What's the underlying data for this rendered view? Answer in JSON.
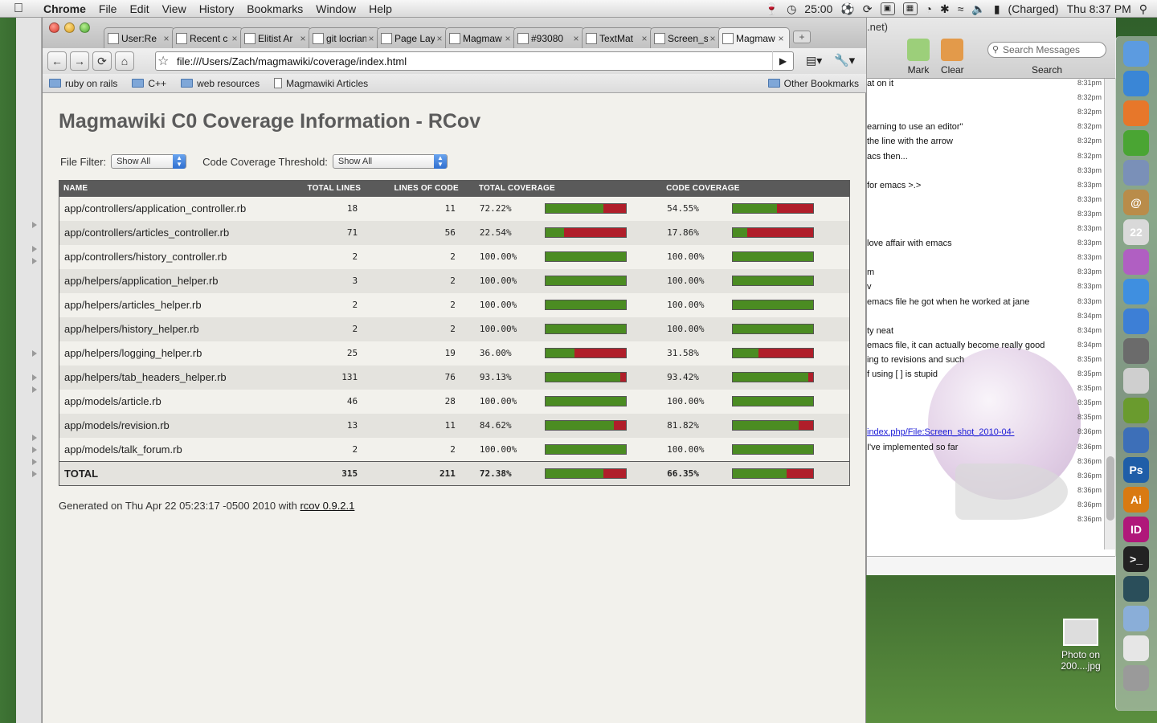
{
  "menubar": {
    "app": "Chrome",
    "items": [
      "File",
      "Edit",
      "View",
      "History",
      "Bookmarks",
      "Window",
      "Help"
    ],
    "timer": "25:00",
    "battery": "(Charged)",
    "clock": "Thu 8:37 PM"
  },
  "tabs": [
    {
      "label": "User:Re",
      "active": false
    },
    {
      "label": "Recent c",
      "active": false
    },
    {
      "label": "Elitist Ar",
      "active": false
    },
    {
      "label": "git locriani",
      "active": false
    },
    {
      "label": "Page Lay",
      "active": false
    },
    {
      "label": "Magmaw",
      "active": false
    },
    {
      "label": "#93080",
      "active": false
    },
    {
      "label": "TextMat",
      "active": false
    },
    {
      "label": "Screen_s",
      "active": false
    },
    {
      "label": "Magmaw",
      "active": true
    }
  ],
  "toolbar": {
    "url": "file:///Users/Zach/magmawiki/coverage/index.html"
  },
  "bookmarks": {
    "items": [
      {
        "label": "ruby on rails",
        "type": "folder"
      },
      {
        "label": "C++",
        "type": "folder"
      },
      {
        "label": "web resources",
        "type": "folder"
      },
      {
        "label": "Magmawiki Articles",
        "type": "page"
      }
    ],
    "other": "Other Bookmarks"
  },
  "page": {
    "title": "Magmawiki C0 Coverage Information - RCov",
    "file_filter_label": "File Filter:",
    "file_filter_value": "Show All",
    "threshold_label": "Code Coverage Threshold:",
    "threshold_value": "Show All",
    "headers": {
      "name": "NAME",
      "total_lines": "TOTAL LINES",
      "lines_of_code": "LINES OF CODE",
      "total_coverage": "TOTAL COVERAGE",
      "code_coverage": "CODE COVERAGE"
    },
    "rows": [
      {
        "name": "app/controllers/application_controller.rb",
        "total_lines": "18",
        "loc": "11",
        "total_cov": "72.22%",
        "total_frac": 0.7222,
        "code_cov": "54.55%",
        "code_frac": 0.5455
      },
      {
        "name": "app/controllers/articles_controller.rb",
        "total_lines": "71",
        "loc": "56",
        "total_cov": "22.54%",
        "total_frac": 0.2254,
        "code_cov": "17.86%",
        "code_frac": 0.1786
      },
      {
        "name": "app/controllers/history_controller.rb",
        "total_lines": "2",
        "loc": "2",
        "total_cov": "100.00%",
        "total_frac": 1.0,
        "code_cov": "100.00%",
        "code_frac": 1.0
      },
      {
        "name": "app/helpers/application_helper.rb",
        "total_lines": "3",
        "loc": "2",
        "total_cov": "100.00%",
        "total_frac": 1.0,
        "code_cov": "100.00%",
        "code_frac": 1.0
      },
      {
        "name": "app/helpers/articles_helper.rb",
        "total_lines": "2",
        "loc": "2",
        "total_cov": "100.00%",
        "total_frac": 1.0,
        "code_cov": "100.00%",
        "code_frac": 1.0
      },
      {
        "name": "app/helpers/history_helper.rb",
        "total_lines": "2",
        "loc": "2",
        "total_cov": "100.00%",
        "total_frac": 1.0,
        "code_cov": "100.00%",
        "code_frac": 1.0
      },
      {
        "name": "app/helpers/logging_helper.rb",
        "total_lines": "25",
        "loc": "19",
        "total_cov": "36.00%",
        "total_frac": 0.36,
        "code_cov": "31.58%",
        "code_frac": 0.3158
      },
      {
        "name": "app/helpers/tab_headers_helper.rb",
        "total_lines": "131",
        "loc": "76",
        "total_cov": "93.13%",
        "total_frac": 0.9313,
        "code_cov": "93.42%",
        "code_frac": 0.9342
      },
      {
        "name": "app/models/article.rb",
        "total_lines": "46",
        "loc": "28",
        "total_cov": "100.00%",
        "total_frac": 1.0,
        "code_cov": "100.00%",
        "code_frac": 1.0
      },
      {
        "name": "app/models/revision.rb",
        "total_lines": "13",
        "loc": "11",
        "total_cov": "84.62%",
        "total_frac": 0.8462,
        "code_cov": "81.82%",
        "code_frac": 0.8182
      },
      {
        "name": "app/models/talk_forum.rb",
        "total_lines": "2",
        "loc": "2",
        "total_cov": "100.00%",
        "total_frac": 1.0,
        "code_cov": "100.00%",
        "code_frac": 1.0
      }
    ],
    "total": {
      "name": "TOTAL",
      "total_lines": "315",
      "loc": "211",
      "total_cov": "72.38%",
      "total_frac": 0.7238,
      "code_cov": "66.35%",
      "code_frac": 0.6635
    },
    "footer_text": "Generated on Thu Apr 22 05:23:17 -0500 2010 with",
    "footer_link": "rcov 0.9.2.1"
  },
  "colors": {
    "covered": "#4b8c22",
    "uncovered": "#b01e2a",
    "header": "#5a5a5a"
  },
  "chat": {
    "title_fragment": ".net)",
    "mark_label": "Mark",
    "clear_label": "Clear",
    "search_placeholder": "Search Messages",
    "search_label": "Search",
    "messages": [
      {
        "text": "at on it",
        "time": "8:31pm"
      },
      {
        "text": "",
        "time": "8:32pm"
      },
      {
        "text": "",
        "time": "8:32pm"
      },
      {
        "text": "earning to use an editor\"",
        "time": "8:32pm"
      },
      {
        "text": "the line with the arrow",
        "time": "8:32pm"
      },
      {
        "text": "acs then...",
        "time": "8:32pm"
      },
      {
        "text": "",
        "time": "8:33pm"
      },
      {
        "text": "for emacs >.>",
        "time": "8:33pm"
      },
      {
        "text": "",
        "time": "8:33pm"
      },
      {
        "text": "",
        "time": "8:33pm"
      },
      {
        "text": "",
        "time": "8:33pm"
      },
      {
        "text": "love affair with emacs",
        "time": "8:33pm"
      },
      {
        "text": "",
        "time": "8:33pm"
      },
      {
        "text": "m",
        "time": "8:33pm"
      },
      {
        "text": "v",
        "time": "8:33pm"
      },
      {
        "text": "emacs file he got when he worked at jane",
        "time": "8:33pm"
      },
      {
        "text": "",
        "time": "8:34pm"
      },
      {
        "text": "ty neat",
        "time": "8:34pm"
      },
      {
        "text": "emacs file, it can actually become really good",
        "time": "8:34pm"
      },
      {
        "text": "ing to revisions and such",
        "time": "8:35pm"
      },
      {
        "text": "f using [ ] is stupid",
        "time": "8:35pm"
      },
      {
        "text": "",
        "time": "8:35pm"
      },
      {
        "text": "",
        "time": "8:35pm"
      },
      {
        "text": "",
        "time": "8:35pm"
      },
      {
        "text": "index.php/File:Screen_shot_2010-04-",
        "time": "8:36pm",
        "link": true
      },
      {
        "text": "I've implemented so far",
        "time": "8:36pm"
      },
      {
        "text": "",
        "time": "8:36pm"
      },
      {
        "text": "",
        "time": "8:36pm"
      },
      {
        "text": "",
        "time": "8:36pm"
      },
      {
        "text": "",
        "time": "8:36pm"
      },
      {
        "text": "",
        "time": "8:36pm"
      }
    ]
  },
  "dock": {
    "items": [
      {
        "icon": "finder-icon",
        "label": "",
        "color": "#5c9be0"
      },
      {
        "icon": "safari-icon",
        "label": "",
        "color": "#3a86d6"
      },
      {
        "icon": "firefox-icon",
        "label": "",
        "color": "#e7772a"
      },
      {
        "icon": "chrome-icon",
        "label": "",
        "color": "#4aa533"
      },
      {
        "icon": "mail-stamp-icon",
        "label": "",
        "color": "#7a90b8"
      },
      {
        "icon": "address-book-icon",
        "label": "@",
        "color": "#b98c4a"
      },
      {
        "icon": "calendar-icon",
        "label": "22",
        "color": "#d9d9d9"
      },
      {
        "icon": "itunes-orb-icon",
        "label": "",
        "color": "#b05fc2"
      },
      {
        "icon": "ichat-icon",
        "label": "",
        "color": "#3f8fe0"
      },
      {
        "icon": "music-icon",
        "label": "",
        "color": "#3d7fd6"
      },
      {
        "icon": "photo-icon",
        "label": "",
        "color": "#6b6b6b"
      },
      {
        "icon": "preview-icon",
        "label": "",
        "color": "#cfcfcf"
      },
      {
        "icon": "textmate-icon",
        "label": "",
        "color": "#6a9b2e"
      },
      {
        "icon": "xcode-icon",
        "label": "",
        "color": "#3d6fb8"
      },
      {
        "icon": "photoshop-icon",
        "label": "Ps",
        "color": "#1f5ea8"
      },
      {
        "icon": "illustrator-icon",
        "label": "Ai",
        "color": "#d97a12"
      },
      {
        "icon": "indesign-icon",
        "label": "ID",
        "color": "#b0187a"
      },
      {
        "icon": "terminal-icon",
        "label": ">_",
        "color": "#222222"
      },
      {
        "icon": "activity-monitor-icon",
        "label": "",
        "color": "#2a4e5a"
      },
      {
        "icon": "folder-icon",
        "label": "",
        "color": "#8aaed8"
      },
      {
        "icon": "document-icon",
        "label": "",
        "color": "#e6e6e6"
      },
      {
        "icon": "trash-icon",
        "label": "",
        "color": "#9a9a9a"
      }
    ]
  },
  "desktop": {
    "file_label": "Photo on 200....jpg"
  }
}
